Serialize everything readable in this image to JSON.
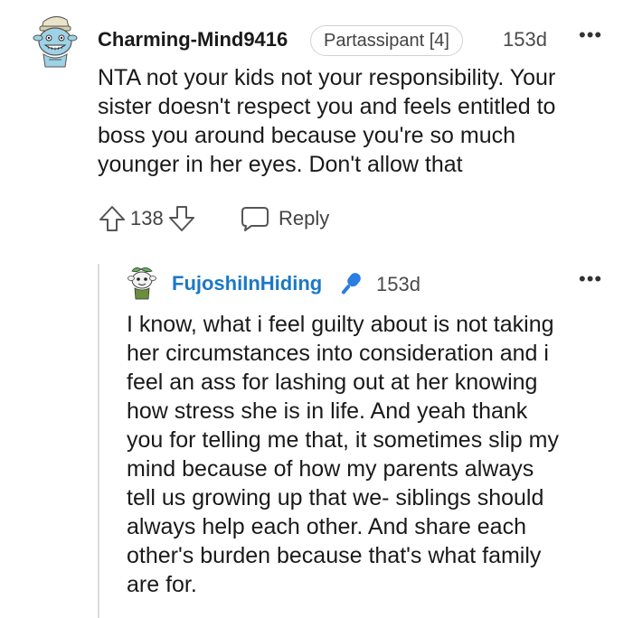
{
  "comments": [
    {
      "username": "Charming-Mind9416",
      "flair": "Partassipant [4]",
      "time": "153d",
      "more": "•••",
      "avatar_icon": "snoo-avatar-icon",
      "body_lines": [
        "NTA not your kids not your responsibility. Your",
        "sister doesn't respect you and feels entitled to",
        "boss you around because you're so much",
        "younger in her eyes. Don't allow that"
      ],
      "score": "138",
      "reply_label": "Reply"
    },
    {
      "username": "FujoshiInHiding",
      "badge_icon": "microphone-icon",
      "time": "153d",
      "more": "•••",
      "avatar_icon": "snoo-avatar-icon",
      "body_lines": [
        "I know, what i feel guilty about is not taking",
        "her circumstances into consideration and i",
        "feel an ass for lashing out at her knowing",
        "how stress she is in life. And yeah thank",
        "you for telling me that, it sometimes slip my",
        "mind because of how my parents always",
        "tell us growing up that we- siblings should",
        "always help each other. And share each",
        "other's burden because that's what family",
        "are for."
      ]
    }
  ],
  "colors": {
    "op_username": "#1b78c7",
    "mic_badge": "#2a7de1",
    "text": "#1a1a1b",
    "meta": "#4a4a4a"
  }
}
